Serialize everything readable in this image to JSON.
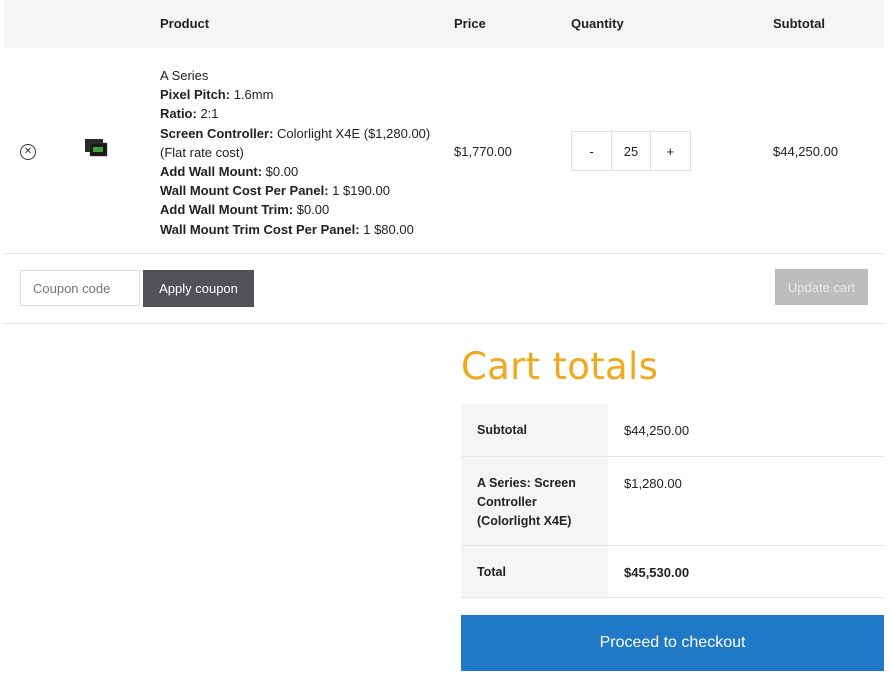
{
  "cart_table": {
    "headers": {
      "product": "Product",
      "price": "Price",
      "quantity": "Quantity",
      "subtotal": "Subtotal"
    },
    "item": {
      "name": "A Series",
      "details": [
        {
          "label": "Pixel Pitch:",
          "value": " 1.6mm"
        },
        {
          "label": "Ratio:",
          "value": " 2:1"
        },
        {
          "label": "Screen Controller:",
          "value": " Colorlight X4E ($1,280.00)"
        },
        {
          "label": "",
          "value": "(Flat rate cost)"
        },
        {
          "label": "Add Wall Mount:",
          "value": " $0.00"
        },
        {
          "label": "Wall Mount Cost Per Panel:",
          "value": " 1 $190.00"
        },
        {
          "label": "Add Wall Mount Trim:",
          "value": " $0.00"
        },
        {
          "label": "Wall Mount Trim Cost Per Panel:",
          "value": " 1 $80.00"
        }
      ],
      "price": "$1,770.00",
      "quantity": "25",
      "qty_minus": "-",
      "qty_plus": "+",
      "subtotal": "$44,250.00",
      "remove_icon": "close-circle-icon"
    }
  },
  "actions": {
    "coupon_placeholder": "Coupon code",
    "apply_label": "Apply coupon",
    "update_label": "Update cart"
  },
  "totals": {
    "title": "Cart totals",
    "rows": [
      {
        "label": "Subtotal",
        "value": "$44,250.00"
      },
      {
        "label": "A Series: Screen Controller (Colorlight X4E)",
        "value": "$1,280.00"
      },
      {
        "label": "Total",
        "value": "$45,530.00"
      }
    ],
    "checkout_label": "Proceed to checkout"
  },
  "colors": {
    "accent_title": "#f0a81c",
    "checkout": "#2079c7",
    "apply_button": "#505256",
    "update_button_disabled": "#bdbdbd"
  }
}
